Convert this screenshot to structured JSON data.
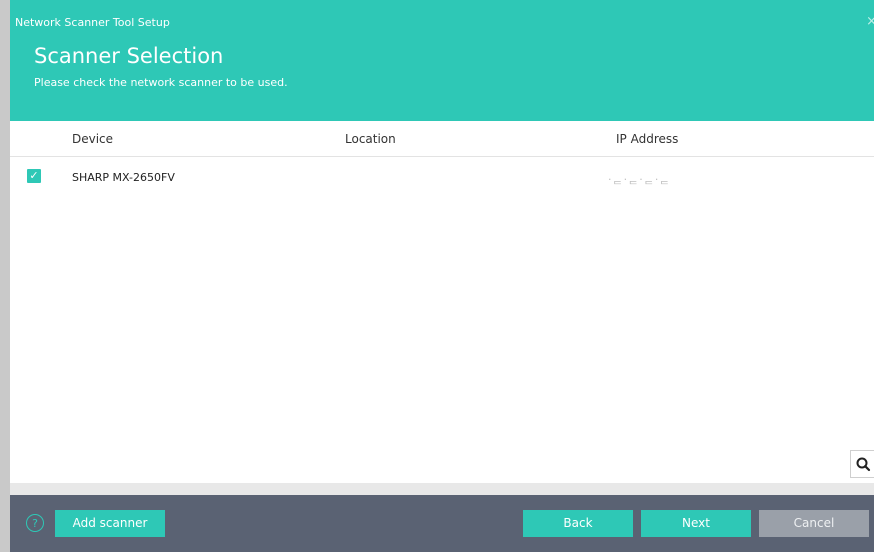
{
  "window": {
    "title": "Network Scanner Tool Setup",
    "close_glyph": "×"
  },
  "header": {
    "heading": "Scanner Selection",
    "subheading": "Please check the network scanner to be used."
  },
  "table": {
    "columns": [
      "Device",
      "Location",
      "IP Address"
    ],
    "rows": [
      {
        "checked": true,
        "device": "SHARP MX-2650FV",
        "location": "",
        "ip": "·ᆮ·ᆮ·ᆮ·ᆮ"
      }
    ]
  },
  "footer": {
    "help_glyph": "?",
    "add_scanner_label": "Add scanner",
    "back_label": "Back",
    "next_label": "Next",
    "cancel_label": "Cancel"
  },
  "colors": {
    "accent": "#2ec8b6",
    "footer_bg": "#5a6273",
    "cancel_bg": "#9aa0a9"
  },
  "icons": {
    "checkbox": "checkmark-icon",
    "search": "search-icon",
    "help": "help-icon",
    "close": "close-icon"
  }
}
